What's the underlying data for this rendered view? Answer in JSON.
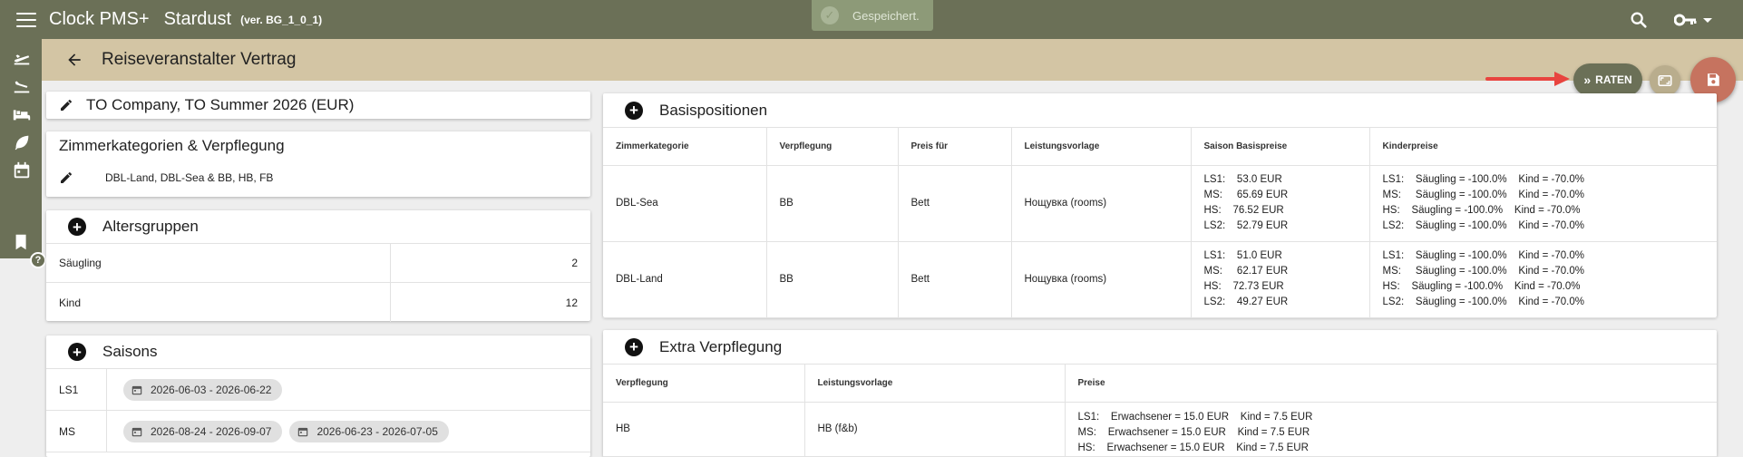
{
  "topbar": {
    "app_name": "Clock PMS+",
    "property": "Stardust",
    "version": "(ver. BG_1_0_1)",
    "toast": "Gespeichert."
  },
  "header": {
    "title": "Reiseveranstalter Vertrag",
    "raten_label": "RATEN"
  },
  "contract": {
    "title": "TO Company, TO Summer 2026 (EUR)"
  },
  "room_categories": {
    "title": "Zimmerkategorien & Verpflegung",
    "value": "DBL-Land, DBL-Sea & BB, HB, FB"
  },
  "age_groups": {
    "title": "Altersgruppen",
    "rows": [
      {
        "name": "Säugling",
        "value": "2"
      },
      {
        "name": "Kind",
        "value": "12"
      }
    ]
  },
  "seasons": {
    "title": "Saisons",
    "rows": [
      {
        "name": "LS1",
        "ranges": [
          "2026-06-03 - 2026-06-22"
        ]
      },
      {
        "name": "MS",
        "ranges": [
          "2026-08-24 - 2026-09-07",
          "2026-06-23 - 2026-07-05"
        ]
      }
    ]
  },
  "base_positions": {
    "title": "Basispositionen",
    "headers": [
      "Zimmerkategorie",
      "Verpflegung",
      "Preis für",
      "Leistungsvorlage",
      "Saison Basispreise",
      "Kinderpreise"
    ],
    "rows": [
      {
        "room": "DBL-Sea",
        "board": "BB",
        "price_for": "Bett",
        "template": "Нощувка (rooms)",
        "season_prices": "LS1:    53.0 EUR\nMS:     65.69 EUR\nHS:    76.52 EUR\nLS2:    52.79 EUR",
        "child_prices": "LS1:    Säugling = -100.0%    Kind = -70.0%\nMS:     Säugling = -100.0%    Kind = -70.0%\nHS:    Säugling = -100.0%    Kind = -70.0%\nLS2:    Säugling = -100.0%    Kind = -70.0%"
      },
      {
        "room": "DBL-Land",
        "board": "BB",
        "price_for": "Bett",
        "template": "Нощувка (rooms)",
        "season_prices": "LS1:    51.0 EUR\nMS:     62.17 EUR\nHS:    72.73 EUR\nLS2:    49.27 EUR",
        "child_prices": "LS1:    Säugling = -100.0%    Kind = -70.0%\nMS:     Säugling = -100.0%    Kind = -70.0%\nHS:    Säugling = -100.0%    Kind = -70.0%\nLS2:    Säugling = -100.0%    Kind = -70.0%"
      }
    ]
  },
  "extra_board": {
    "title": "Extra Verpflegung",
    "headers": [
      "Verpflegung",
      "Leistungsvorlage",
      "Preise"
    ],
    "rows": [
      {
        "board": "HB",
        "template": "HB (f&b)",
        "prices": "LS1:    Erwachsener = 15.0 EUR    Kind = 7.5 EUR\nMS:    Erwachsener = 15.0 EUR    Kind = 7.5 EUR\nHS:    Erwachsener = 15.0 EUR    Kind = 7.5 EUR"
      }
    ]
  },
  "colors": {
    "topbar": "#6b7057",
    "band": "#d3c5a4",
    "save_button": "#c6735f",
    "arrow": "#e8443f"
  }
}
